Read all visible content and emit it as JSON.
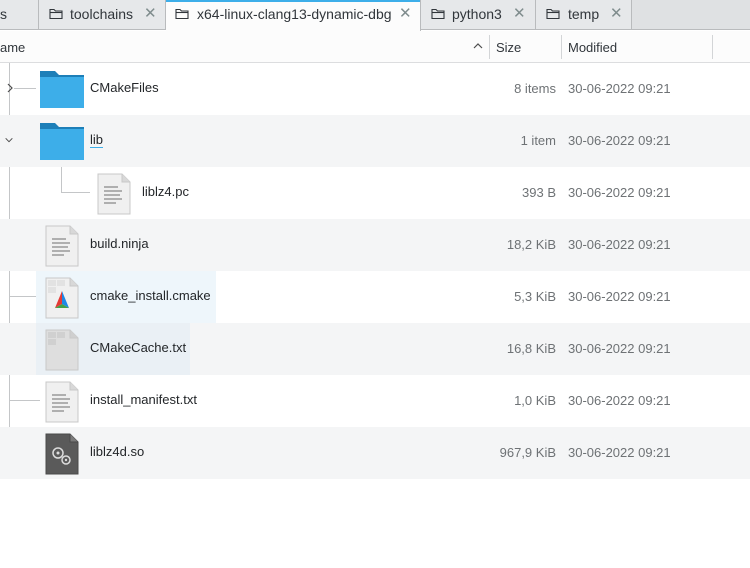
{
  "tabs": [
    {
      "label": "s",
      "active": false,
      "closable": false
    },
    {
      "label": "toolchains",
      "active": false,
      "closable": true
    },
    {
      "label": "x64-linux-clang13-dynamic-dbg",
      "active": true,
      "closable": true
    },
    {
      "label": "python3",
      "active": false,
      "closable": true
    },
    {
      "label": "temp",
      "active": false,
      "closable": true
    }
  ],
  "columns": {
    "name": "ame",
    "size": "Size",
    "modified": "Modified"
  },
  "colors": {
    "accent": "#3daee9",
    "folder": "#3daee9",
    "folder_dark": "#1d7fb8"
  },
  "files": [
    {
      "name": "CMakeFiles",
      "size": "8 items",
      "modified": "30-06-2022 09:21",
      "icon": "folder-icon",
      "expanded": false
    },
    {
      "name": "lib",
      "size": "1 item",
      "modified": "30-06-2022 09:21",
      "icon": "folder-icon",
      "expanded": true
    },
    {
      "name": "liblz4.pc",
      "size": "393 B",
      "modified": "30-06-2022 09:21",
      "icon": "text-file-icon"
    },
    {
      "name": "build.ninja",
      "size": "18,2 KiB",
      "modified": "30-06-2022 09:21",
      "icon": "text-file-icon"
    },
    {
      "name": "cmake_install.cmake",
      "size": "5,3 KiB",
      "modified": "30-06-2022 09:21",
      "icon": "cmake-file-icon"
    },
    {
      "name": "CMakeCache.txt",
      "size": "16,8 KiB",
      "modified": "30-06-2022 09:21",
      "icon": "text-file-icon"
    },
    {
      "name": "install_manifest.txt",
      "size": "1,0 KiB",
      "modified": "30-06-2022 09:21",
      "icon": "text-file-icon"
    },
    {
      "name": "liblz4d.so",
      "size": "967,9 KiB",
      "modified": "30-06-2022 09:21",
      "icon": "shared-library-icon"
    }
  ]
}
